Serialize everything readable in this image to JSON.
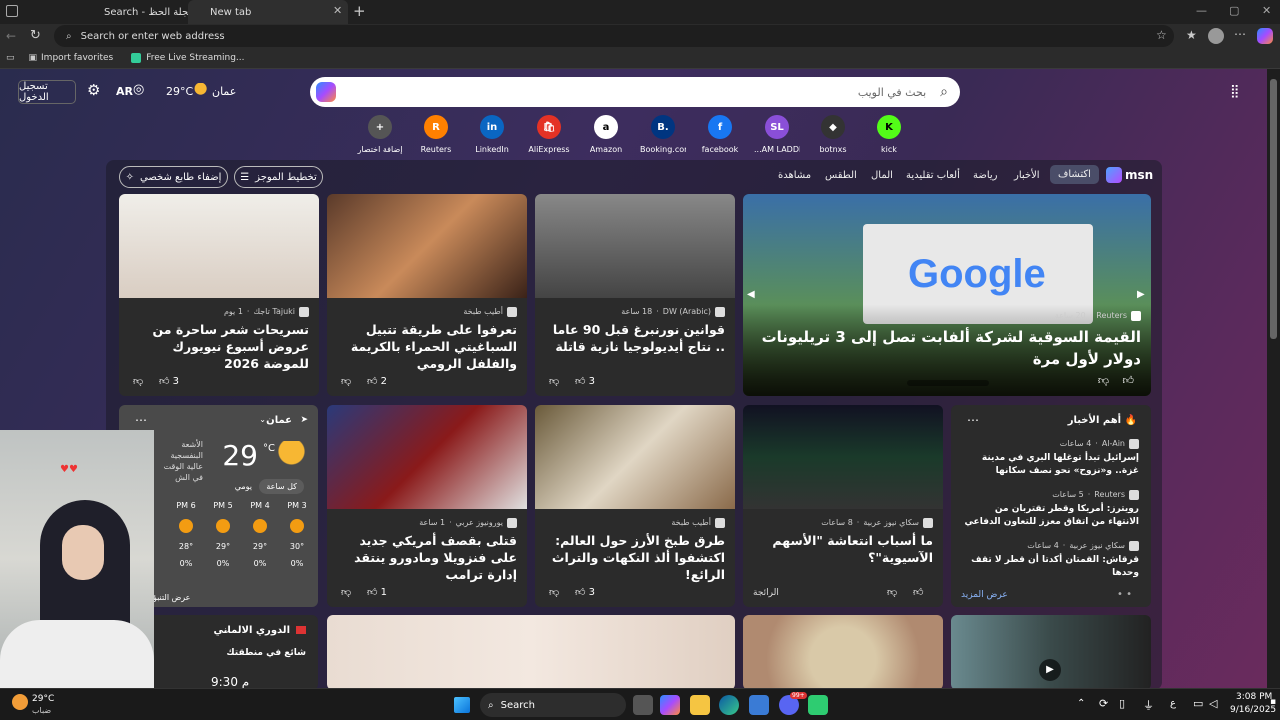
{
  "tabs": [
    {
      "label": "Search - عجلة الحظ"
    },
    {
      "label": "New tab"
    }
  ],
  "address": {
    "placeholder": "Search or enter web address"
  },
  "favorites": [
    {
      "label": "Import favorites"
    },
    {
      "label": "Free Live Streaming..."
    }
  ],
  "header": {
    "login": "تسجيل الدخول",
    "lang": "AR",
    "temp": "29°C",
    "city": "عمان"
  },
  "search": {
    "placeholder": "بحث في الويب"
  },
  "tiles": [
    {
      "label": "kick",
      "mark": "K",
      "color": "#53fc18",
      "text": "#000"
    },
    {
      "label": "botnxs",
      "mark": "◆",
      "color": "#333",
      "text": "#fff"
    },
    {
      "label": "...AM LADDER",
      "mark": "SL",
      "color": "#8a4fd8",
      "text": "#fff"
    },
    {
      "label": "facebook",
      "mark": "f",
      "color": "#1877f2",
      "text": "#fff"
    },
    {
      "label": "Booking.com",
      "mark": "B.",
      "color": "#003580",
      "text": "#fff"
    },
    {
      "label": "Amazon",
      "mark": "a",
      "color": "#fff",
      "text": "#000"
    },
    {
      "label": "AliExpress",
      "mark": "🛍",
      "color": "#e43225",
      "text": "#fff"
    },
    {
      "label": "LinkedIn",
      "mark": "in",
      "color": "#0a66c2",
      "text": "#fff"
    },
    {
      "label": "Reuters",
      "mark": "R",
      "color": "#ff8000",
      "text": "#fff"
    },
    {
      "label": "إضافة اختصار",
      "mark": "+",
      "color": "#555",
      "text": "#fff"
    }
  ],
  "nav": {
    "brand": "msn",
    "items": [
      "اكتشاف",
      "الأخبار",
      "رياضة",
      "ألعاب تقليدية",
      "المال",
      "الطقس",
      "مشاهدة"
    ],
    "layout_btn": "تخطيط الموجز",
    "personalize_btn": "إضفاء طابع شخصي"
  },
  "hero": {
    "source": "Reuters",
    "time": "20 ساعة",
    "headline": "القيمة السوقية لشركة ألفابت تصل إلى 3 تريليونات دولار لأول مرة",
    "logo_text": "Google"
  },
  "row1": [
    {
      "source": "DW (Arabic)",
      "time": "18 ساعة",
      "headline": "قوانين نورنبرغ قبل 90 عاما .. نتاج أيديولوجيا نازية قاتلة",
      "likes": "3"
    },
    {
      "source": "أطيب طبخة",
      "time": "",
      "headline": "تعرفوا على طريقة تتبيل السباغيتي الحمراء بالكريمة والفلفل الرومي",
      "likes": "2"
    },
    {
      "source": "Tajuki تاجك",
      "time": "1 يوم",
      "headline": "تسريحات شعر ساحرة من عروض أسبوع نيويورك للموضة 2026",
      "likes": "3"
    }
  ],
  "topnews": {
    "title": "أهم الأخبار",
    "items": [
      {
        "source": "Al-Ain",
        "time": "4 ساعات",
        "headline": "إسرائيل تبدأ توغلها البري في مدينة غزة.. و«نزوح» نحو نصف سكانها"
      },
      {
        "source": "Reuters",
        "time": "5 ساعات",
        "headline": "رويترز: أمريكا وقطر تقتربان من الانتهاء من اتفاق معزز للتعاون الدفاعي"
      },
      {
        "source": "سكاي نيوز عربية",
        "time": "4 ساعات",
        "headline": "قرقاش: القمتان أكدتا أن قطر لا تقف وحدها"
      }
    ],
    "more": "عرض المزيد"
  },
  "row2": [
    {
      "source": "سكاي نيوز عربية",
      "time": "8 ساعات",
      "headline": "ما أسباب انتعاشة \"الأسهم الآسيوية\"؟",
      "foot": "الرائجة"
    },
    {
      "source": "أطيب طبخة",
      "time": "",
      "headline": "طرق طبخ الأرز حول العالم: اكتشفوا ألذ النكهات والتراث الرائع!",
      "likes": "3"
    },
    {
      "source": "يورونيوز عربي",
      "time": "1 ساعة",
      "headline": "قتلى بقصف أمريكي جديد على فنزويلا ومادورو ينتقد إدارة ترامب",
      "likes": "1"
    }
  ],
  "weather": {
    "city": "عمان",
    "temp": "29",
    "unit": "°C",
    "desc": "الأشعة البنفسجية عالية الوقت في الش",
    "tabs": [
      "كل ساعة",
      "يومي"
    ],
    "hours": [
      {
        "time": "PM 3",
        "temp": "30°",
        "rain": "0%"
      },
      {
        "time": "PM 4",
        "temp": "29°",
        "rain": "0%"
      },
      {
        "time": "PM 5",
        "temp": "29°",
        "rain": "0%"
      },
      {
        "time": "PM 6",
        "temp": "28°",
        "rain": "0%"
      }
    ],
    "forecast": "عرض التنبؤ"
  },
  "league": {
    "title": "الدوري الالماني",
    "subtitle": "شائع في منطقتك",
    "time": "9:30 م"
  },
  "taskbar": {
    "temp": "29°C",
    "cond": "ضباب",
    "search": "Search",
    "lang": "ع",
    "time": "3:08 PM",
    "date": "9/16/2025",
    "badge": "99+"
  },
  "colors": {
    "accent": "#6e5bd6",
    "page_bg": "#3a2a55"
  }
}
